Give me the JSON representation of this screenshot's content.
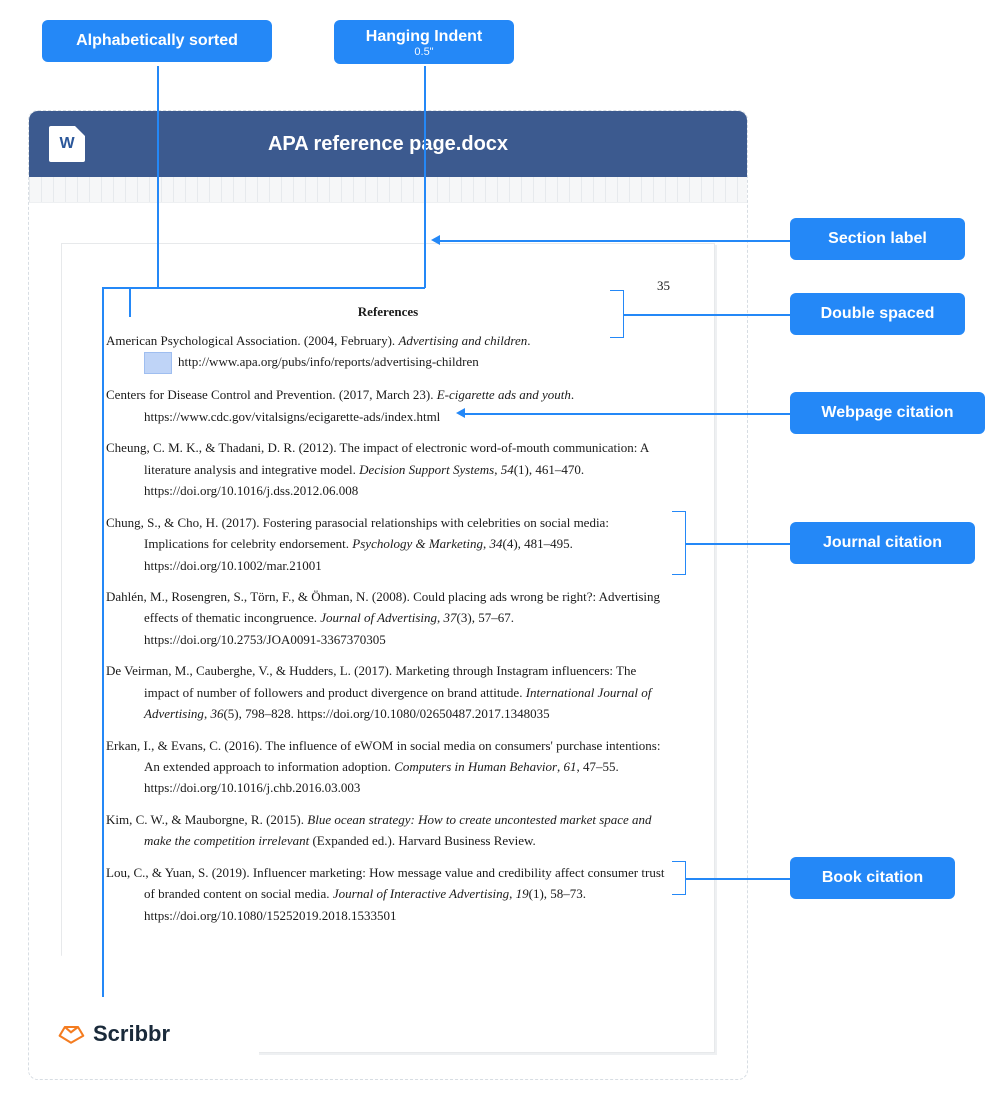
{
  "callouts": {
    "alpha": "Alphabetically sorted",
    "indent": "Hanging Indent",
    "indent_sub": "0.5\"",
    "section_label": "Section label",
    "double_spaced": "Double spaced",
    "webpage": "Webpage citation",
    "journal": "Journal citation",
    "book": "Book citation"
  },
  "doc": {
    "title": "APA reference page.docx",
    "word_glyph": "W",
    "page_number": "35",
    "section_title": "References"
  },
  "refs": {
    "r1a": "American Psychological Association. (2004, February). ",
    "r1b": "Advertising and children",
    "r1c": ".",
    "r1_url": "http://www.apa.org/pubs/info/reports/advertising-children",
    "r2a": "Centers for Disease Control and Prevention. (2017, March 23). ",
    "r2b": "E-cigarette ads and youth",
    "r2c": ". https://www.cdc.gov/vitalsigns/ecigarette-ads/index.html",
    "r3a": "Cheung, C. M. K., & Thadani, D. R. (2012). The impact of electronic word-of-mouth communication: A literature analysis and integrative model. ",
    "r3b": "Decision Support Systems",
    "r3c": ", ",
    "r3d": "54",
    "r3e": "(1), 461–470. https://doi.org/10.1016/j.dss.2012.06.008",
    "r4a": "Chung, S., & Cho, H. (2017). Fostering parasocial relationships with celebrities on social media: Implications for celebrity endorsement. ",
    "r4b": "Psychology & Marketing",
    "r4c": ", ",
    "r4d": "34",
    "r4e": "(4), 481–495. https://doi.org/10.1002/mar.21001",
    "r5a": "Dahlén, M., Rosengren, S., Törn, F., & Öhman, N. (2008). Could placing ads wrong be right?: Advertising effects of thematic incongruence. ",
    "r5b": "Journal of Advertising",
    "r5c": ", ",
    "r5d": "37",
    "r5e": "(3), 57–67. https://doi.org/10.2753/JOA0091-3367370305",
    "r6a": "De Veirman, M., Cauberghe, V., & Hudders, L. (2017). Marketing through Instagram influencers: The impact of number of followers and product divergence on brand attitude. ",
    "r6b": "International Journal of Advertising",
    "r6c": ", ",
    "r6d": "36",
    "r6e": "(5), 798–828. https://doi.org/10.1080/02650487.2017.1348035",
    "r7a": "Erkan, I., & Evans, C. (2016). The influence of eWOM in social media on consumers' purchase intentions: An extended approach to information adoption. ",
    "r7b": "Computers in Human Behavior",
    "r7c": ", ",
    "r7d": "61",
    "r7e": ", 47–55. https://doi.org/10.1016/j.chb.2016.03.003",
    "r8a": "Kim, C. W., & Mauborgne, R. (2015). ",
    "r8b": "Blue ocean strategy: How to create uncontested market space and make the competition irrelevant",
    "r8c": " (Expanded ed.). Harvard Business Review.",
    "r9a": "Lou, C., & Yuan, S. (2019). Influencer marketing: How message value and credibility affect consumer trust of branded content on social media. ",
    "r9b": "Journal of Interactive Advertising",
    "r9c": ", ",
    "r9d": "19",
    "r9e": "(1), 58–73. https://doi.org/10.1080/15252019.2018.1533501"
  },
  "brand": "Scribbr"
}
